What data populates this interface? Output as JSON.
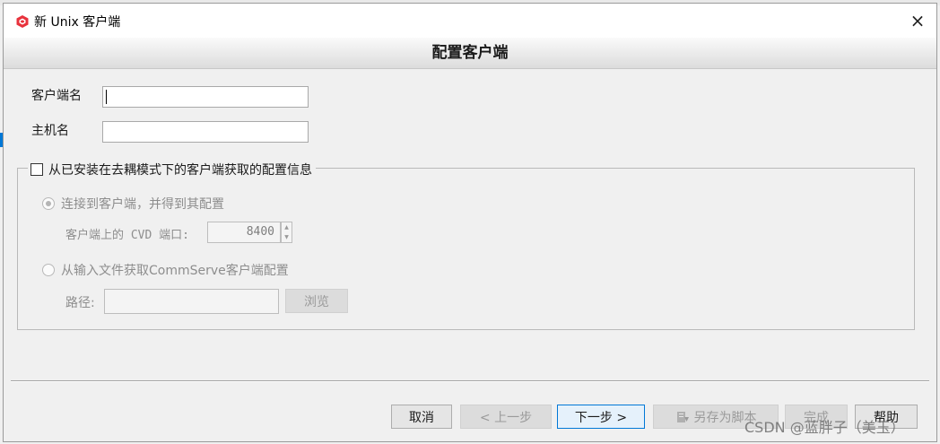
{
  "window": {
    "title": "新 Unix 客户端",
    "close_label": "×"
  },
  "banner": {
    "title": "配置客户端"
  },
  "form": {
    "client_name_label": "客户端名",
    "client_name_value": "",
    "hostname_label": "主机名",
    "hostname_value": ""
  },
  "group": {
    "checkbox_label": "从已安装在去耦模式下的客户端获取的配置信息",
    "checkbox_checked": false,
    "radio_connect_label": "连接到客户端，并得到其配置",
    "cvd_port_label": "客户端上的 CVD 端口:",
    "cvd_port_value": "8400",
    "spin_up": "▲",
    "spin_down": "▼",
    "radio_file_label": "从输入文件获取CommServe客户端配置",
    "path_label": "路径:",
    "path_value": "",
    "browse_label": "浏览"
  },
  "buttons": {
    "cancel": "取消",
    "back": "< 上一步",
    "next": "下一步 >",
    "save_script": "另存为脚本",
    "finish": "完成",
    "help": "帮助"
  },
  "watermark": "CSDN @蓝胖子（美玉）",
  "colors": {
    "accent": "#0078d7",
    "app_icon": "#e8323c"
  }
}
